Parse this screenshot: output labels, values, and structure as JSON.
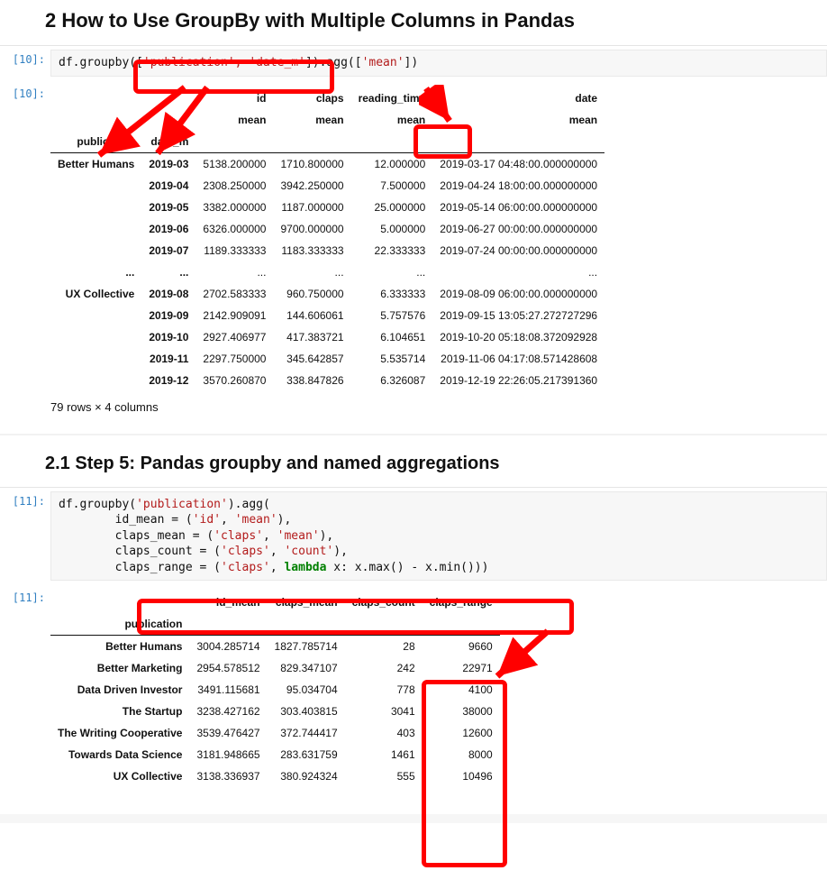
{
  "section2": {
    "title": "2  How to Use GroupBy with Multiple Columns in Pandas",
    "in_prompt": "[10]:",
    "out_prompt": "[10]:",
    "code_prefix": "df.groupby([",
    "code_args": "'publication', 'date_m'",
    "code_suffix1": "]).agg([",
    "code_suffix_str": "'mean'",
    "code_suffix2": "])",
    "table": {
      "top_headers": [
        "",
        "",
        "id",
        "claps",
        "reading_time",
        "date"
      ],
      "sub_headers": [
        "",
        "",
        "mean",
        "mean",
        "mean",
        "mean"
      ],
      "index_headers": [
        "publication",
        "date_m",
        "",
        "",
        "",
        ""
      ],
      "ellipsis_row": [
        "...",
        "...",
        "...",
        "...",
        "...",
        "..."
      ],
      "rows_a": [
        [
          "Better Humans",
          "2019-03",
          "5138.200000",
          "1710.800000",
          "12.000000",
          "2019-03-17 04:48:00.000000000"
        ],
        [
          "",
          "2019-04",
          "2308.250000",
          "3942.250000",
          "7.500000",
          "2019-04-24 18:00:00.000000000"
        ],
        [
          "",
          "2019-05",
          "3382.000000",
          "1187.000000",
          "25.000000",
          "2019-05-14 06:00:00.000000000"
        ],
        [
          "",
          "2019-06",
          "6326.000000",
          "9700.000000",
          "5.000000",
          "2019-06-27 00:00:00.000000000"
        ],
        [
          "",
          "2019-07",
          "1189.333333",
          "1183.333333",
          "22.333333",
          "2019-07-24 00:00:00.000000000"
        ]
      ],
      "rows_b": [
        [
          "UX Collective",
          "2019-08",
          "2702.583333",
          "960.750000",
          "6.333333",
          "2019-08-09 06:00:00.000000000"
        ],
        [
          "",
          "2019-09",
          "2142.909091",
          "144.606061",
          "5.757576",
          "2019-09-15 13:05:27.272727296"
        ],
        [
          "",
          "2019-10",
          "2927.406977",
          "417.383721",
          "6.104651",
          "2019-10-20 05:18:08.372092928"
        ],
        [
          "",
          "2019-11",
          "2297.750000",
          "345.642857",
          "5.535714",
          "2019-11-06 04:17:08.571428608"
        ],
        [
          "",
          "2019-12",
          "3570.260870",
          "338.847826",
          "6.326087",
          "2019-12-19 22:26:05.217391360"
        ]
      ],
      "shape_note": "79 rows × 4 columns"
    }
  },
  "section21": {
    "title": "2.1  Step 5: Pandas groupby and named aggregations",
    "in_prompt": "[11]:",
    "out_prompt": "[11]:",
    "code": {
      "l1a": "df.groupby(",
      "l1s": "'publication'",
      "l1b": ").agg(",
      "l2a": "        id_mean = (",
      "l2s1": "'id'",
      "l2m": ", ",
      "l2s2": "'mean'",
      "l2b": "),",
      "l3a": "        claps_mean = (",
      "l3s1": "'claps'",
      "l3m": ", ",
      "l3s2": "'mean'",
      "l3b": "),",
      "l4a": "        claps_count = (",
      "l4s1": "'claps'",
      "l4m": ", ",
      "l4s2": "'count'",
      "l4b": "),",
      "l5a": "        claps_range = (",
      "l5s1": "'claps'",
      "l5m": ", ",
      "l5kw": "lambda",
      "l5b": " x: x.max() - x.min()))"
    },
    "table": {
      "headers": [
        "",
        "id_mean",
        "claps_mean",
        "claps_count",
        "claps_range"
      ],
      "index_header": "publication",
      "rows": [
        [
          "Better Humans",
          "3004.285714",
          "1827.785714",
          "28",
          "9660"
        ],
        [
          "Better Marketing",
          "2954.578512",
          "829.347107",
          "242",
          "22971"
        ],
        [
          "Data Driven Investor",
          "3491.115681",
          "95.034704",
          "778",
          "4100"
        ],
        [
          "The Startup",
          "3238.427162",
          "303.403815",
          "3041",
          "38000"
        ],
        [
          "The Writing Cooperative",
          "3539.476427",
          "372.744417",
          "403",
          "12600"
        ],
        [
          "Towards Data Science",
          "3181.948665",
          "283.631759",
          "1461",
          "8000"
        ],
        [
          "UX Collective",
          "3138.336937",
          "380.924324",
          "555",
          "10496"
        ]
      ]
    }
  }
}
